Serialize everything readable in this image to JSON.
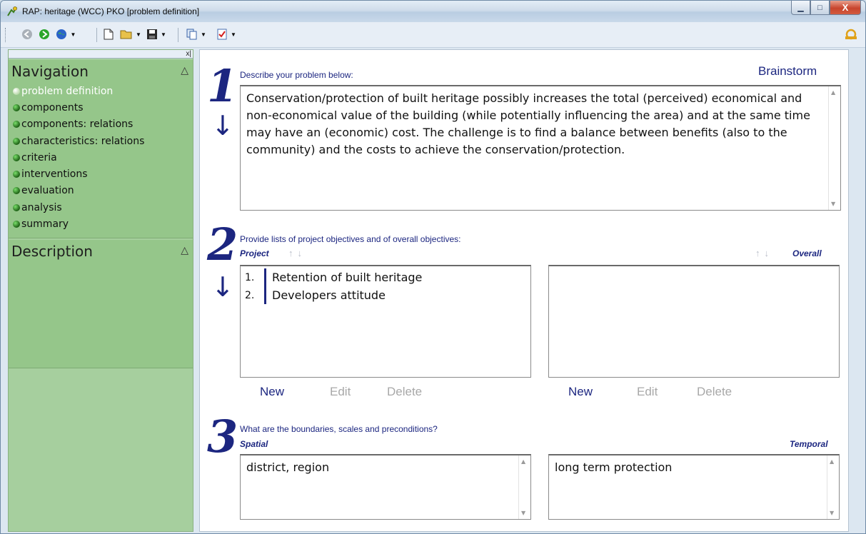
{
  "window": {
    "title": "RAP: heritage (WCC) PKO [problem definition]",
    "buttons": {
      "minimize": "▁",
      "maximize": "□",
      "close": "X"
    }
  },
  "toolbar": {
    "icons": [
      "back-icon",
      "forward-icon",
      "globe-icon",
      "new-document-icon",
      "open-folder-icon",
      "save-icon",
      "copy-icon",
      "checklist-icon",
      "help-icon"
    ]
  },
  "sidebar": {
    "close_glyph": "x|",
    "navigation": {
      "title": "Navigation",
      "collapse_glyph": "△",
      "items": [
        {
          "label": "problem definition",
          "active": true
        },
        {
          "label": "components",
          "active": false
        },
        {
          "label": "components: relations",
          "active": false
        },
        {
          "label": "characteristics: relations",
          "active": false
        },
        {
          "label": "criteria",
          "active": false
        },
        {
          "label": "interventions",
          "active": false
        },
        {
          "label": "evaluation",
          "active": false
        },
        {
          "label": "analysis",
          "active": false
        },
        {
          "label": "summary",
          "active": false
        }
      ]
    },
    "description": {
      "title": "Description",
      "collapse_glyph": "△"
    }
  },
  "main": {
    "step1": {
      "number": "1",
      "arrow": "↓",
      "label": "Describe your problem below:",
      "brainstorm": "Brainstorm",
      "problem_text": "Conservation/protection of built heritage possibly increases the total (perceived) economical and non-economical value of the building (while potentially influencing the area) and at the same time may have an (economic) cost. The challenge is to  find a balance between benefits (also to the community) and the costs to achieve the conservation/protection."
    },
    "step2": {
      "number": "2",
      "arrow": "↓",
      "label": "Provide lists of project objectives and of overall objectives:",
      "project_label": "Project",
      "overall_label": "Overall",
      "sort_arrows": "↑↓",
      "project_items": [
        {
          "num": "1.",
          "text": "Retention of built heritage"
        },
        {
          "num": "2.",
          "text": "Developers attitude"
        }
      ],
      "actions": {
        "new": "New",
        "edit": "Edit",
        "delete": "Delete"
      }
    },
    "step3": {
      "number": "3",
      "label": "What are the boundaries, scales and preconditions?",
      "spatial_label": "Spatial",
      "temporal_label": "Temporal",
      "spatial_text": "district, region",
      "temporal_text": "long term protection"
    }
  },
  "colors": {
    "accent": "#1c2680",
    "sidebar": "#95c68a",
    "disabled": "#a8a8a8"
  }
}
